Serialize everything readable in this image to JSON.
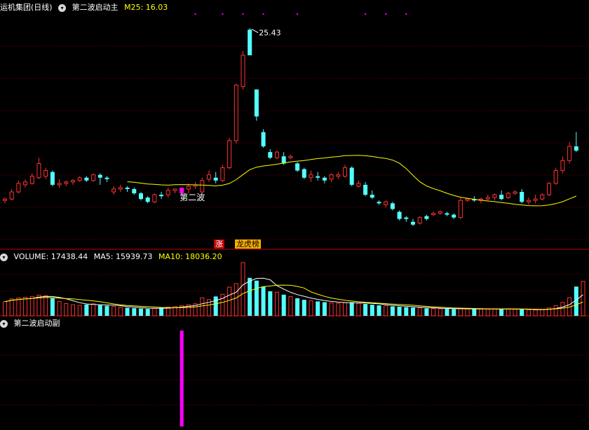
{
  "main_panel": {
    "title": "运机集团(日线)",
    "indicator_name": "第二波启动主",
    "ma_label": "M25: 16.03",
    "annotation": "第二波",
    "peak_label": "25.43"
  },
  "tags": {
    "rise": "涨",
    "dragon_tiger": "龙虎榜"
  },
  "volume_panel": {
    "volume_label": "VOLUME: 17438.44",
    "ma5_label": "MA5: 15939.73",
    "ma10_label": "MA10: 18036.20"
  },
  "sub_panel": {
    "indicator_name": "第二波启动副"
  },
  "colors": {
    "up": "#ff3232",
    "down": "#54ffff",
    "ma25": "#ffff00",
    "ma5": "#ffffff",
    "ma10": "#ffff00",
    "signal": "#ff00ff",
    "grid": "#800000",
    "label": "#ffffff"
  },
  "chart_data": [
    {
      "type": "candlestick",
      "title": "运机集团(日线)",
      "series": [
        {
          "name": "K线",
          "ohlc": [
            [
              13.4,
              13.6,
              13.2,
              13.5
            ],
            [
              13.5,
              14.2,
              13.4,
              14.0
            ],
            [
              14.0,
              14.8,
              13.9,
              14.6
            ],
            [
              14.5,
              14.9,
              14.3,
              14.7
            ],
            [
              14.6,
              15.3,
              14.5,
              15.1
            ],
            [
              15.0,
              16.4,
              14.9,
              16.0
            ],
            [
              15.1,
              15.7,
              14.9,
              15.5
            ],
            [
              15.4,
              15.5,
              14.4,
              14.5
            ],
            [
              14.5,
              14.9,
              14.3,
              14.6
            ],
            [
              14.6,
              14.8,
              14.4,
              14.7
            ],
            [
              14.7,
              14.9,
              14.5,
              14.8
            ],
            [
              14.8,
              15.1,
              14.7,
              15.0
            ],
            [
              15.0,
              15.1,
              14.7,
              14.8
            ],
            [
              14.8,
              15.3,
              14.7,
              15.2
            ],
            [
              15.2,
              15.3,
              14.5,
              15.0
            ],
            [
              15.0,
              15.1,
              14.7,
              14.9
            ],
            [
              14.0,
              14.4,
              13.8,
              14.2
            ],
            [
              14.2,
              14.5,
              14.0,
              14.3
            ],
            [
              14.3,
              14.4,
              14.0,
              14.2
            ],
            [
              14.2,
              14.3,
              13.8,
              13.9
            ],
            [
              13.9,
              14.0,
              13.4,
              13.5
            ],
            [
              13.6,
              13.7,
              13.2,
              13.3
            ],
            [
              13.3,
              13.9,
              13.2,
              13.8
            ],
            [
              13.8,
              14.0,
              13.5,
              13.7
            ],
            [
              13.8,
              14.3,
              13.6,
              14.1
            ],
            [
              14.1,
              14.2,
              13.9,
              14.2
            ],
            [
              14.1,
              14.3,
              13.9,
              14.2
            ],
            [
              14.2,
              14.6,
              13.9,
              14.4
            ],
            [
              14.4,
              14.7,
              14.2,
              14.5
            ],
            [
              14.0,
              15.0,
              13.9,
              14.8
            ],
            [
              14.9,
              15.5,
              14.7,
              15.2
            ],
            [
              15.0,
              15.4,
              14.6,
              14.8
            ],
            [
              14.8,
              15.9,
              14.7,
              15.7
            ],
            [
              15.7,
              17.8,
              15.6,
              17.6
            ],
            [
              17.6,
              21.6,
              17.4,
              21.5
            ],
            [
              21.4,
              23.9,
              21.2,
              23.6
            ],
            [
              25.4,
              25.5,
              23.6,
              23.6
            ],
            [
              21.2,
              21.2,
              19.0,
              19.3
            ],
            [
              18.2,
              18.4,
              17.1,
              17.2
            ],
            [
              16.8,
              17.0,
              16.3,
              16.4
            ],
            [
              16.4,
              16.9,
              16.3,
              16.8
            ],
            [
              16.5,
              16.8,
              15.9,
              16.0
            ],
            [
              16.4,
              16.6,
              16.3,
              16.5
            ],
            [
              16.0,
              16.1,
              15.4,
              15.5
            ],
            [
              15.6,
              15.7,
              14.9,
              15.0
            ],
            [
              15.0,
              15.5,
              14.7,
              15.2
            ],
            [
              15.1,
              15.4,
              14.8,
              15.0
            ],
            [
              15.0,
              15.1,
              14.6,
              14.8
            ],
            [
              14.9,
              15.3,
              14.7,
              15.2
            ],
            [
              15.1,
              15.4,
              14.9,
              15.2
            ],
            [
              15.1,
              15.9,
              15.0,
              15.7
            ],
            [
              15.7,
              15.8,
              14.4,
              14.5
            ],
            [
              14.4,
              14.8,
              14.3,
              14.6
            ],
            [
              14.5,
              14.7,
              13.7,
              13.8
            ],
            [
              13.8,
              14.1,
              13.5,
              13.6
            ],
            [
              13.3,
              13.4,
              13.1,
              13.2
            ],
            [
              13.1,
              13.4,
              12.9,
              13.3
            ],
            [
              13.2,
              13.3,
              12.7,
              12.8
            ],
            [
              12.6,
              12.7,
              12.0,
              12.1
            ],
            [
              12.2,
              12.3,
              11.9,
              12.1
            ],
            [
              11.9,
              12.1,
              11.6,
              11.7
            ],
            [
              11.8,
              12.3,
              11.7,
              12.2
            ],
            [
              12.3,
              12.4,
              12.0,
              12.1
            ],
            [
              12.4,
              12.6,
              12.3,
              12.5
            ],
            [
              12.5,
              12.7,
              12.4,
              12.6
            ],
            [
              12.5,
              12.6,
              12.3,
              12.4
            ],
            [
              12.4,
              12.5,
              12.1,
              12.2
            ],
            [
              12.2,
              13.6,
              12.1,
              13.4
            ],
            [
              13.4,
              13.6,
              13.3,
              13.5
            ],
            [
              13.5,
              13.7,
              13.3,
              13.4
            ],
            [
              13.4,
              13.6,
              13.2,
              13.5
            ],
            [
              13.5,
              13.8,
              13.4,
              13.6
            ],
            [
              13.6,
              13.9,
              13.4,
              13.8
            ],
            [
              13.8,
              14.1,
              13.4,
              13.5
            ],
            [
              13.6,
              14.0,
              13.5,
              13.9
            ],
            [
              13.9,
              14.1,
              13.8,
              14.0
            ],
            [
              14.0,
              14.2,
              13.2,
              13.3
            ],
            [
              13.3,
              13.6,
              13.1,
              13.4
            ],
            [
              13.4,
              13.8,
              13.2,
              13.5
            ],
            [
              13.5,
              13.9,
              13.4,
              13.8
            ],
            [
              13.8,
              14.7,
              13.7,
              14.6
            ],
            [
              14.6,
              15.7,
              14.5,
              15.5
            ],
            [
              15.5,
              16.5,
              15.3,
              16.2
            ],
            [
              16.2,
              17.5,
              16.0,
              17.2
            ],
            [
              17.2,
              18.2,
              16.8,
              16.9
            ]
          ]
        },
        {
          "name": "M25",
          "last": 16.03
        }
      ],
      "peak_value": 25.43,
      "ylim": [
        11.0,
        26.5
      ],
      "grid": true
    },
    {
      "type": "bar",
      "title": "VOLUME",
      "series": [
        {
          "name": "VOLUME",
          "values": [
            7200,
            8600,
            9100,
            9400,
            9800,
            10500,
            10200,
            8900,
            7300,
            6200,
            5600,
            5300,
            5700,
            6100,
            5400,
            5100,
            4700,
            4300,
            4100,
            3900,
            3700,
            3500,
            3800,
            4100,
            4400,
            4700,
            5200,
            5600,
            6100,
            9100,
            8200,
            9800,
            10900,
            14500,
            16300,
            26900,
            19200,
            17800,
            14800,
            12400,
            11900,
            10700,
            9700,
            8900,
            8100,
            7600,
            7300,
            6900,
            6500,
            6300,
            6600,
            6900,
            6400,
            6000,
            5600,
            5300,
            5100,
            4800,
            4600,
            4400,
            4200,
            4000,
            3800,
            3700,
            3600,
            3500,
            3400,
            3700,
            3500,
            3600,
            3400,
            3300,
            3500,
            3600,
            3400,
            3300,
            3200,
            3100,
            3000,
            3200,
            4000,
            5200,
            6800,
            9200,
            14800,
            17438.44
          ]
        },
        {
          "name": "MA5",
          "last": 15939.73
        },
        {
          "name": "MA10",
          "last": 18036.2
        }
      ],
      "grid": true
    },
    {
      "type": "bar",
      "title": "第二波启动副",
      "series": [
        {
          "name": "第二波启动副",
          "signal_index": 30,
          "values": [
            1
          ]
        }
      ],
      "grid": true
    }
  ]
}
